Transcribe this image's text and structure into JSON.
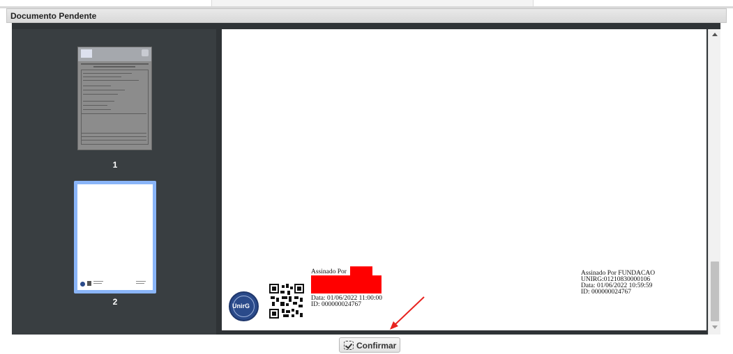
{
  "window": {
    "title": "Documento Pendente"
  },
  "sidebar": {
    "pages": [
      {
        "label": "1"
      },
      {
        "label": "2",
        "selected": true
      }
    ],
    "thumb1_logo_text": "UnirG"
  },
  "document": {
    "signature_left": {
      "line1": "Assinado Por",
      "date": "Data: 01/06/2022 11:00:00",
      "id": "ID: 000000024767"
    },
    "signature_right": {
      "line1": "Assinado Por FUNDACAO",
      "line2": "UNIRG:01210830000106",
      "date": "Data: 01/06/2022 10:59:59",
      "id": "ID: 000000024767"
    },
    "seal_text": "UnirG"
  },
  "footer": {
    "confirm_label": "Confirmar"
  },
  "colors": {
    "annotation_arrow": "#e8231f",
    "selected_thumb_border": "#8ab5f8",
    "redaction": "#ff0000"
  }
}
